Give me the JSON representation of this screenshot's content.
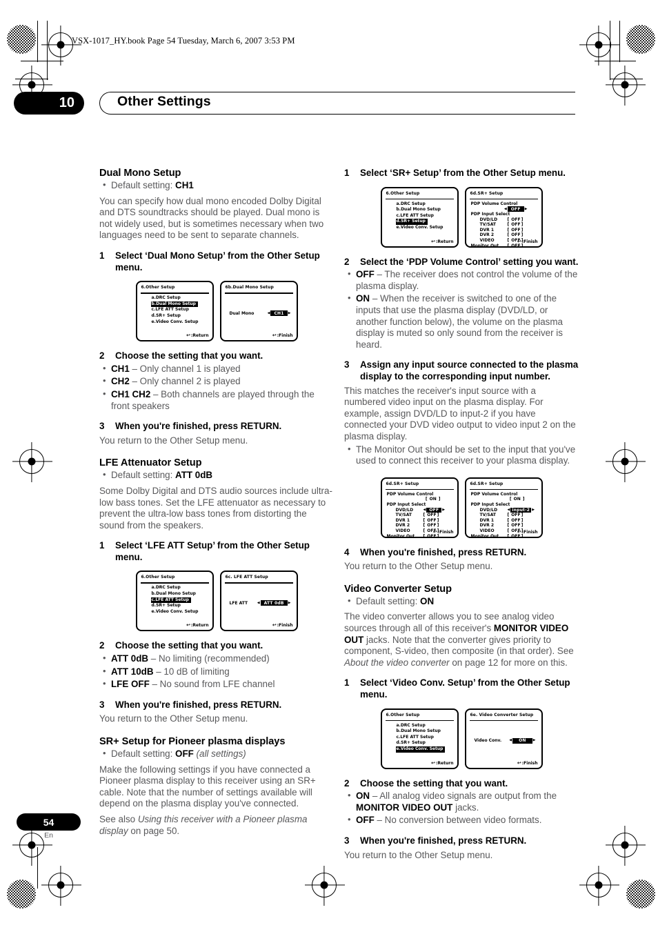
{
  "header": {
    "book_line": "VSX-1017_HY.book  Page 54  Tuesday, March 6, 2007  3:53 PM",
    "chapter_number": "10",
    "chapter_title": "Other Settings"
  },
  "footer": {
    "page_number": "54",
    "language": "En"
  },
  "left_column": {
    "dual_mono": {
      "heading": "Dual Mono Setup",
      "default_label": "Default setting: ",
      "default_value": "CH1",
      "intro": "You can specify how dual mono encoded Dolby Digital and DTS soundtracks should be played. Dual mono is not widely used, but is sometimes necessary when two languages need to be sent to separate channels.",
      "step1_num": "1",
      "step1_text": "Select ‘Dual Mono Setup’ from the Other Setup menu.",
      "step2_num": "2",
      "step2_text": "Choose the setting that you want.",
      "options": [
        {
          "name": "CH1",
          "desc": " – Only channel 1 is played"
        },
        {
          "name": "CH2",
          "desc": " – Only channel 2 is played"
        },
        {
          "name": "CH1 CH2",
          "desc": " – Both channels are played through the front speakers"
        }
      ],
      "step3_num": "3",
      "step3_text": "When you're finished, press RETURN.",
      "step3_after": "You return to the Other Setup menu."
    },
    "lfe": {
      "heading": "LFE Attenuator Setup",
      "default_label": "Default setting: ",
      "default_value": "ATT 0dB",
      "intro": "Some Dolby Digital and DTS audio sources include ultra-low bass tones. Set the LFE attenuator as necessary to prevent the ultra-low bass tones from distorting the sound from the speakers.",
      "step1_num": "1",
      "step1_text": "Select ‘LFE ATT Setup’ from the Other Setup menu.",
      "step2_num": "2",
      "step2_text": "Choose the setting that you want.",
      "options": [
        {
          "name": "ATT 0dB",
          "desc": " – No limiting (recommended)"
        },
        {
          "name": "ATT 10dB",
          "desc": " – 10 dB of limiting"
        },
        {
          "name": "LFE OFF",
          "desc": " – No sound from LFE channel"
        }
      ],
      "step3_num": "3",
      "step3_text": "When you're finished, press RETURN.",
      "step3_after": "You return to the Other Setup menu."
    },
    "srplus": {
      "heading": "SR+ Setup for Pioneer plasma displays",
      "default_label": "Default setting: ",
      "default_value": "OFF",
      "default_suffix": " (all settings)",
      "para1": "Make the following settings if you have connected a Pioneer plasma display to this receiver using an SR+ cable. Note that the number of settings available will depend on the plasma display you've connected.",
      "para2_prefix": "See also ",
      "para2_italic": "Using this receiver with a Pioneer plasma display",
      "para2_suffix": " on page 50."
    }
  },
  "right_column": {
    "srplus_steps": {
      "step1_num": "1",
      "step1_text": "Select ‘SR+ Setup’ from the Other Setup menu.",
      "step2_num": "2",
      "step2_text": "Select the ‘PDP Volume Control’ setting you want.",
      "options": [
        {
          "name": "OFF",
          "desc": " – The receiver does not control the volume of the plasma display."
        },
        {
          "name": "ON",
          "desc": " – When the receiver is switched to one of the inputs that use the plasma display (DVD/LD, or another function below), the volume on the plasma display is muted so only sound from the receiver is heard."
        }
      ],
      "step3_num": "3",
      "step3_text": "Assign any input source connected to the plasma display to the corresponding input number.",
      "step3_body": "This matches the receiver's input source with a numbered video input on the plasma display. For example, assign DVD/LD to input-2 if you have connected your DVD video output to video input 2 on the plasma display.",
      "step3_bullet": "The Monitor Out should be set to the input that you've used to connect this receiver to your plasma display.",
      "step4_num": "4",
      "step4_text": "When you're finished, press RETURN.",
      "step4_after": "You return to the Other Setup menu."
    },
    "video_converter": {
      "heading": "Video Converter Setup",
      "default_label": "Default setting: ",
      "default_value": "ON",
      "intro": "The video converter allows you to see analog video sources through all of this receiver's MONITOR VIDEO OUT jacks. Note that the converter gives priority to component, S-video, then composite (in that order). See About the video converter on page 12 for more on this.",
      "step1_num": "1",
      "step1_text": "Select ‘Video Conv. Setup’ from the Other Setup menu.",
      "step2_num": "2",
      "step2_text": "Choose the setting that you want.",
      "options": [
        {
          "name": "ON",
          "desc": " – All analog video signals are output from the MONITOR VIDEO OUT jacks."
        },
        {
          "name": "OFF",
          "desc": " – No conversion between video formats."
        }
      ],
      "step3_num": "3",
      "step3_text": "When you're finished, press RETURN.",
      "step3_after": "You return to the Other Setup menu."
    }
  },
  "osd": {
    "other_setup_title": "6.Other  Setup",
    "menu_items": [
      "a.DRC  Setup",
      "b.Dual  Mono  Setup",
      "c.LFE  ATT  Setup",
      "d.SR+  Setup",
      "e.Video Conv. Setup"
    ],
    "return_label": ":Return",
    "finish_label": ":Finish",
    "dual_mono": {
      "title": "6b.Dual  Mono  Setup",
      "row_label": "Dual Mono",
      "value": "CH1"
    },
    "lfe_att": {
      "title": "6c. LFE  ATT  Setup",
      "row_label": "LFE ATT",
      "value": "ATT 0dB"
    },
    "video_conv": {
      "title": "6e. Video Converter Setup",
      "row_label": "Video Conv.",
      "value": "ON"
    },
    "srplus": {
      "title": "6d.SR+  Setup",
      "vol_heading": "PDP  Volume  Control",
      "input_heading": "PDP  Input  Select",
      "inputs": [
        "DVD/LD",
        "TV/SAT",
        "DVR 1",
        "DVR 2",
        "VIDEO"
      ],
      "monitor_label": "Monitor Out",
      "screen_a": {
        "vol_value": "OFF",
        "vol_selected": true,
        "values": [
          "OFF",
          "OFF",
          "OFF",
          "OFF",
          "OFF"
        ],
        "monitor_value": "OFF",
        "highlight_index": -1
      },
      "screen_b": {
        "vol_value": "ON",
        "vol_selected": false,
        "values": [
          "OFF",
          "OFF",
          "OFF",
          "OFF",
          "OFF"
        ],
        "monitor_value": "OFF",
        "highlight_index": 0
      },
      "screen_c": {
        "vol_value": "ON",
        "vol_selected": false,
        "values": [
          "input-2",
          "OFF",
          "OFF",
          "OFF",
          "OFF"
        ],
        "monitor_value": "OFF",
        "highlight_index": 0
      }
    }
  }
}
